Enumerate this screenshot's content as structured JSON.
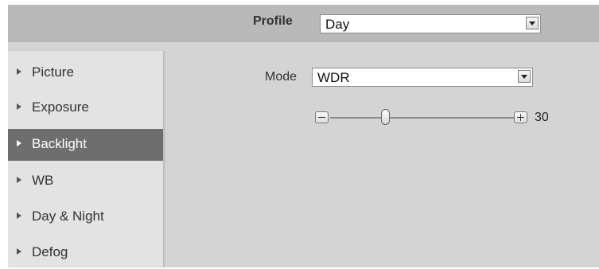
{
  "header": {
    "profile_label": "Profile",
    "profile_value": "Day"
  },
  "sidebar": {
    "items": [
      {
        "label": "Picture",
        "active": false
      },
      {
        "label": "Exposure",
        "active": false
      },
      {
        "label": "Backlight",
        "active": true
      },
      {
        "label": "WB",
        "active": false
      },
      {
        "label": "Day & Night",
        "active": false
      },
      {
        "label": "Defog",
        "active": false
      }
    ]
  },
  "main": {
    "mode_label": "Mode",
    "mode_value": "WDR",
    "slider": {
      "value": "30",
      "level_fraction": 0.3
    }
  },
  "icons": {
    "dropdown": "chevron-down-icon",
    "decrease": "minus-icon",
    "increase": "plus-icon",
    "menu_arrow": "triangle-right-icon"
  },
  "colors": {
    "header_bg": "#b9b9b9",
    "sidebar_bg": "#e3e3e3",
    "active_item_bg": "#6e6e6e",
    "content_bg": "#d4d4d4"
  }
}
